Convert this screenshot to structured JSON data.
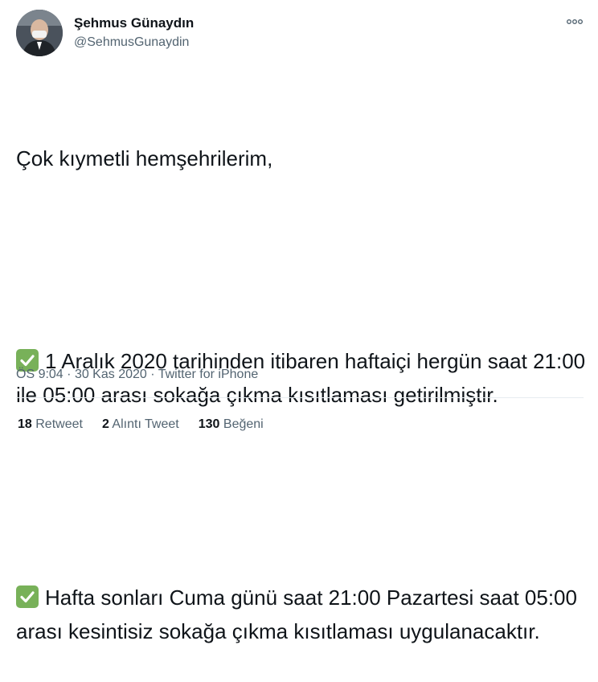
{
  "author": {
    "display_name": "Şehmus Günaydın",
    "handle": "@SehmusGunaydin"
  },
  "tweet": {
    "greeting": "Çok kıymetli hemşehrilerim,",
    "item1": "1 Aralık 2020 tarihinden itibaren haftaiçi hergün saat 21:00 ile 05:00 arası sokağa çıkma kısıtlaması getirilmiştir.",
    "item2": "Hafta sonları Cuma günü saat 21:00 Pazartesi saat 05:00 arası kesintisiz sokağa çıkma kısıtlaması uygulanacaktır."
  },
  "meta": {
    "time": "ÖS 9:04",
    "date": "30 Kas 2020",
    "source": "Twitter for iPhone"
  },
  "stats": {
    "retweets_count": "18",
    "retweets_label": "Retweet",
    "quotes_count": "2",
    "quotes_label": "Alıntı Tweet",
    "likes_count": "130",
    "likes_label": "Beğeni"
  },
  "icons": {
    "more": "more-horizontal-icon",
    "check": "check-mark-button-icon"
  },
  "colors": {
    "check_green": "#78b159",
    "secondary_text": "#536471"
  }
}
